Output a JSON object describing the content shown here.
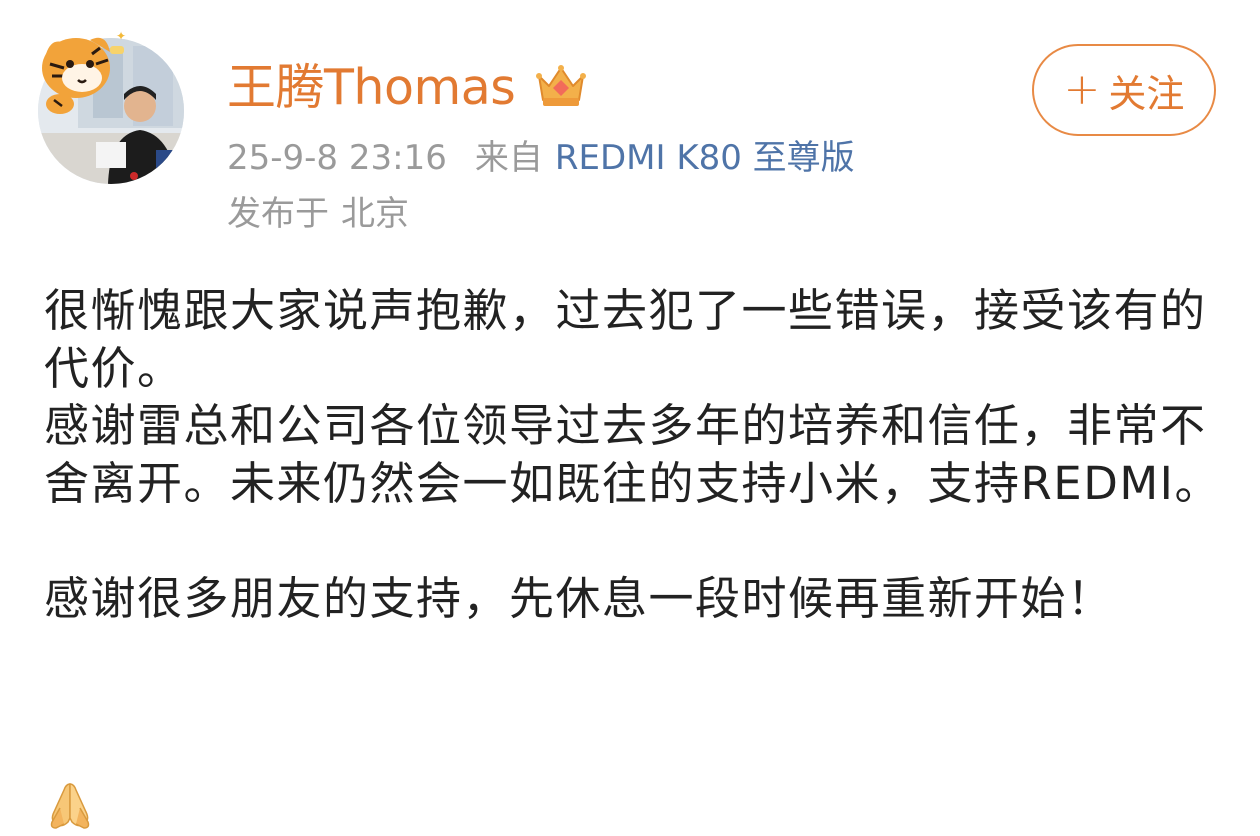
{
  "post": {
    "author": {
      "name": "王腾Thomas",
      "badge_icon": "crown-vip-icon"
    },
    "meta": {
      "time": "25-9-8 23:16",
      "from_label": "来自",
      "device": "REDMI K80 至尊版",
      "location_prefix": "发布于",
      "location": "北京"
    },
    "follow_button": {
      "plus": "+",
      "label": "关注"
    },
    "paragraphs": [
      "很惭愧跟大家说声抱歉，过去犯了一些错误，接受该有的代价。",
      "感谢雷总和公司各位领导过去多年的培养和信任，非常不舍离开。未来仍然会一如既往的支持小米，支持REDMI。",
      "",
      "感谢很多朋友的支持，先休息一段时候再重新开始！"
    ],
    "trailing_emoji_icon": "folded-hands-icon"
  },
  "colors": {
    "username": "#e27a32",
    "follow_border": "#e88a45",
    "device_link": "#4f74a8",
    "meta_gray": "#9a9a9a",
    "body_text": "#222222"
  }
}
